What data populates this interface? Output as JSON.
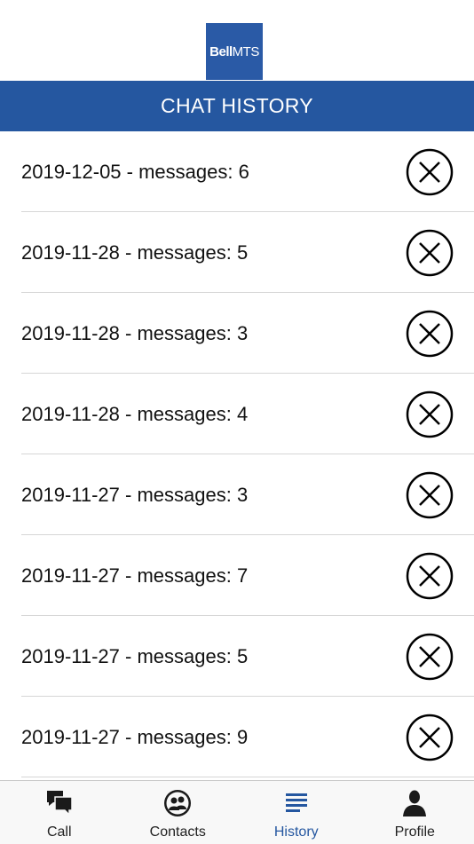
{
  "app": {
    "logo_bold": "Bell",
    "logo_light": "MTS",
    "brand_color": "#2557a0"
  },
  "header": {
    "title": "CHAT HISTORY"
  },
  "history": {
    "items": [
      {
        "label": "2019-12-05 - messages: 6"
      },
      {
        "label": "2019-11-28 - messages: 5"
      },
      {
        "label": "2019-11-28 - messages: 3"
      },
      {
        "label": "2019-11-28 - messages: 4"
      },
      {
        "label": "2019-11-27 - messages: 3"
      },
      {
        "label": "2019-11-27 - messages: 7"
      },
      {
        "label": "2019-11-27 - messages: 5"
      },
      {
        "label": "2019-11-27 - messages: 9"
      }
    ],
    "delete_icon": "circle-x-icon"
  },
  "tabbar": {
    "tabs": [
      {
        "label": "Call",
        "icon": "chat-bubbles-icon",
        "active": false
      },
      {
        "label": "Contacts",
        "icon": "contacts-icon",
        "active": false
      },
      {
        "label": "History",
        "icon": "list-lines-icon",
        "active": true
      },
      {
        "label": "Profile",
        "icon": "person-icon",
        "active": false
      }
    ]
  }
}
